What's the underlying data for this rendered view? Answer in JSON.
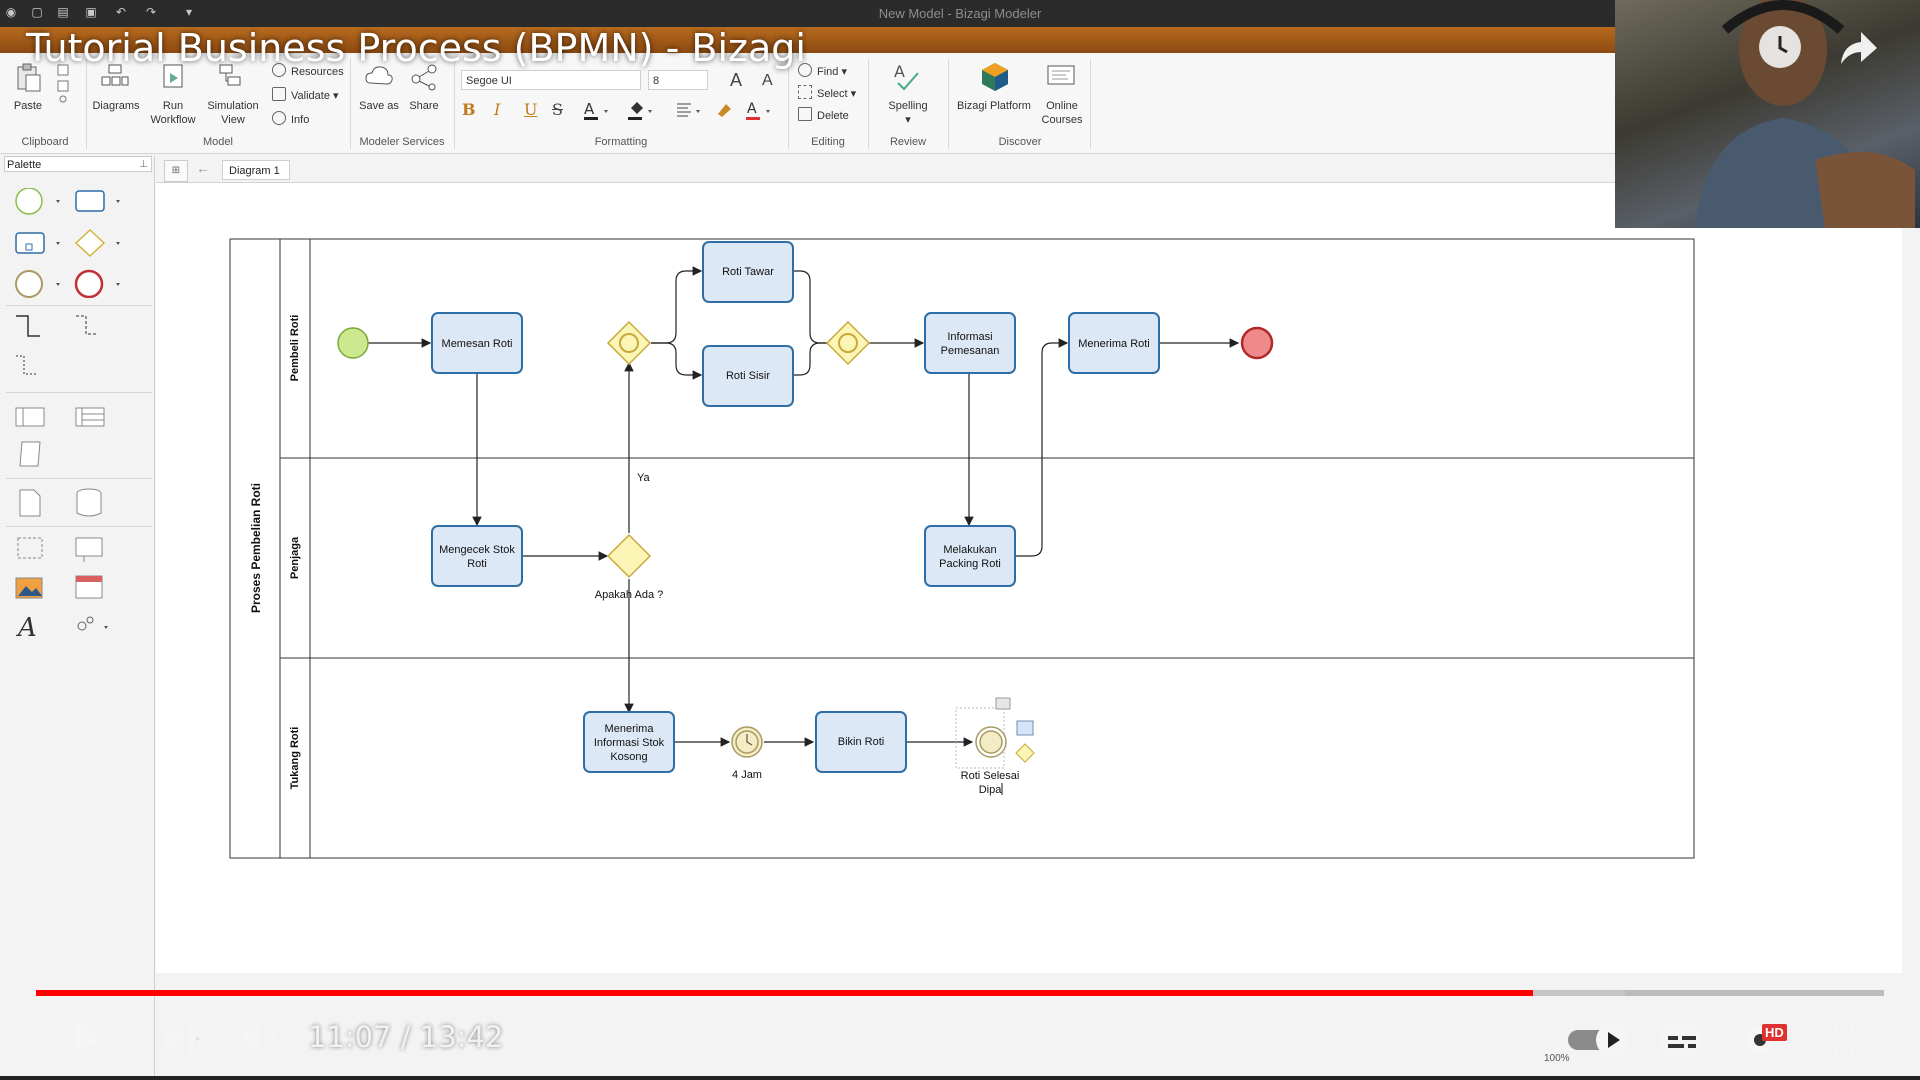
{
  "window": {
    "title": "New Model - Bizagi Modeler"
  },
  "video": {
    "title": "Tutorial Business Process (BPMN) - Bizagi",
    "current_time": "11:07",
    "duration": "13:42",
    "time_display": "11:07 / 13:42",
    "progress": 0.81,
    "buffered": 0.86,
    "quality_badge": "HD",
    "zoom": "100%"
  },
  "ribbon": {
    "clipboard": {
      "paste": "Paste",
      "label": "Clipboard"
    },
    "model": {
      "diagrams": "Diagrams",
      "run_workflow_1": "Run",
      "run_workflow_2": "Workflow",
      "simulation_1": "Simulation",
      "simulation_2": "View",
      "resources": "Resources",
      "validate": "Validate",
      "info": "Info",
      "label": "Model"
    },
    "modeler_services": {
      "save_as": "Save as",
      "share": "Share",
      "label": "Modeler Services"
    },
    "formatting": {
      "font": "Segoe UI",
      "size": "8",
      "label": "Formatting"
    },
    "editing": {
      "find": "Find",
      "select": "Select",
      "delete": "Delete",
      "label": "Editing"
    },
    "review": {
      "spelling": "Spelling",
      "label": "Review"
    },
    "discover": {
      "platform": "Bizagi Platform",
      "courses_1": "Online",
      "courses_2": "Courses",
      "label": "Discover"
    }
  },
  "palette": {
    "title": "Palette"
  },
  "tabs": {
    "diagram": "Diagram 1"
  },
  "diagram": {
    "pool": "Proses Pembelian Roti",
    "lanes": [
      "Pembeli Roti",
      "Penjaga",
      "Tukang Roti"
    ],
    "tasks": {
      "memesan": "Memesan Roti",
      "tawar": "Roti Tawar",
      "sisir": "Roti Sisir",
      "info_pemesanan_1": "Informasi",
      "info_pemesanan_2": "Pemesanan",
      "menerima_roti": "Menerima Roti",
      "cek_stok_1": "Mengecek Stok",
      "cek_stok_2": "Roti",
      "packing_1": "Melakukan",
      "packing_2": "Packing Roti",
      "info_kosong_1": "Menerima",
      "info_kosong_2": "Informasi Stok",
      "info_kosong_3": "Kosong",
      "bikin": "Bikin Roti"
    },
    "labels": {
      "ya": "Ya",
      "gateway": "Apakah Ada ?",
      "timer": "4 Jam",
      "event_edit_1": "Roti Selesai",
      "event_edit_2": "Dipa"
    }
  },
  "colors": {
    "accent": "#d36f1a",
    "task_fill": "#dde8f6",
    "task_border": "#2e6ea6",
    "gateway_fill": "#fbf6b5",
    "start_fill": "#cde98f",
    "end_fill": "#ef8a8a",
    "progress": "#ff0000"
  }
}
